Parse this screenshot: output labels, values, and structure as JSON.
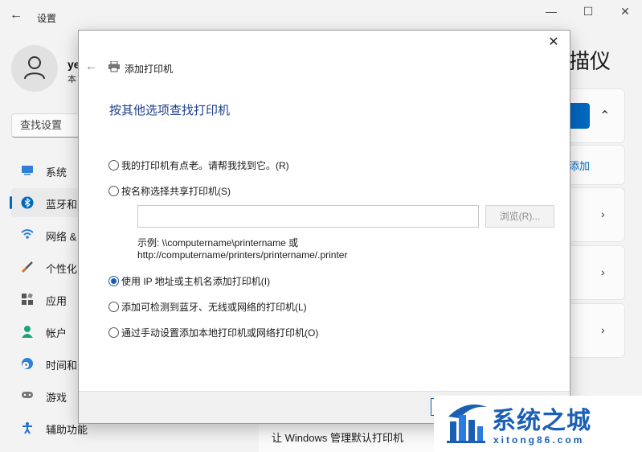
{
  "settings": {
    "title": "设置",
    "back_icon": "back-arrow-icon",
    "user": {
      "name": "ye",
      "sub": "本"
    },
    "search_placeholder": "查找设置",
    "nav": [
      {
        "label": "系统",
        "icon": "monitor-icon",
        "color": "#2f7fd6"
      },
      {
        "label": "蓝牙和",
        "icon": "bluetooth-icon",
        "color": "#0067c0",
        "active": true
      },
      {
        "label": "网络 &",
        "icon": "wifi-icon",
        "color": "#2f7fd6"
      },
      {
        "label": "个性化",
        "icon": "brush-icon",
        "color": "#e07020"
      },
      {
        "label": "应用",
        "icon": "apps-icon",
        "color": "#555555"
      },
      {
        "label": "帐户",
        "icon": "account-icon",
        "color": "#1aa37a"
      },
      {
        "label": "时间和",
        "icon": "clock-globe-icon",
        "color": "#2f7fd6"
      },
      {
        "label": "游戏",
        "icon": "gamepad-icon",
        "color": "#777777"
      },
      {
        "label": "辅助功能",
        "icon": "accessibility-icon",
        "color": "#1f6fd1"
      }
    ],
    "page_heading": "描仪",
    "add_link": "添加",
    "bottom_text": "让 Windows 管理默认打印机",
    "window_controls": {
      "minimize": "—",
      "maximize": "☐",
      "close": "✕"
    }
  },
  "dialog": {
    "title": "添加打印机",
    "close_glyph": "✕",
    "back_glyph": "←",
    "heading": "按其他选项查找打印机",
    "options": [
      {
        "label": "我的打印机有点老。请帮我找到它。(R)",
        "checked": false
      },
      {
        "label": "按名称选择共享打印机(S)",
        "checked": false
      },
      {
        "label": "使用 IP 地址或主机名添加打印机(I)",
        "checked": true
      },
      {
        "label": "添加可检测到蓝牙、无线或网络的打印机(L)",
        "checked": false
      },
      {
        "label": "通过手动设置添加本地打印机或网络打印机(O)",
        "checked": false
      }
    ],
    "share_input_value": "",
    "browse_label": "浏览(R)...",
    "example_line1": "示例: \\\\computername\\printername 或",
    "example_line2": "http://computername/printers/printername/.printer"
  },
  "watermark": {
    "main": "系统之城",
    "url": "xitong86.com"
  }
}
